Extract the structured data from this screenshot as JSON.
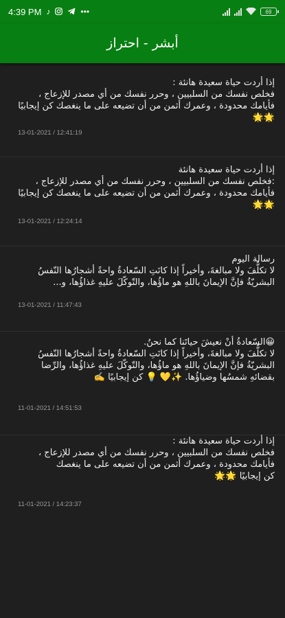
{
  "status_bar": {
    "time": "4:39 PM",
    "icons_left": [
      "tiktok-icon",
      "instagram-icon",
      "telegram-icon",
      "more-dots-icon"
    ],
    "battery": "69"
  },
  "app_bar": {
    "title": "أبشر - احتراز"
  },
  "messages": [
    {
      "text": "إذا أردت حياة سعيدة هانئة :\nفخلص نفسك من السلبيين ، وحرر نفسك من أي مصدر للإزعاج ، فأيامك محدودة ، وعمرك أثمن من أن تضيعه على ما ينغصك كن إيجابيًا 🌟🌟",
      "date": "13-01-2021 / 12:41:19"
    },
    {
      "text": "إذا أردت حياة سعيدة هانئة\n:فخلص نفسك من السلبيين ، وحرر نفسك من أي مصدر للإزعاج ، فأيامك محدودة ، وعمرك أثمن من أن تضيعه على ما ينغصك كن إيجابيًا 🌟🌟",
      "date": "13-01-2021 / 12:24:14"
    },
    {
      "text": "رسالة اليوم\nلا تكلُّفَ ولا مبالغةَ، وأخيراً إذا كانَتِ السّعادةُ واحةً أشجارُها النّفسُ البشريّةُ فإنَّ الإيمانَ باللهِ هو ماؤُها، والتّوكّلَ عليهِ غذاؤُها، و...",
      "date": "13-01-2021 / 11:47:43"
    },
    {
      "text": "😀السّعادةُ أنْ نعيشَ حياتَنا كما نحنُ.\nلا تكلُّفَ ولا مبالغةَ، وأخيراً إذا كانَتِ السّعادةُ واحةً أشجارُها النّفسُ البشريّةُ فإنَّ الإيمانَ باللهِ هو ماؤُها، والتّوكّلَ عليهِ غذاؤُها، والرِّضا بقضائهِ شمسُها وضياؤُها. ✨💛 💡 كن إيجابيًا ✍️",
      "date": "11-01-2021 / 14:51:53"
    },
    {
      "text": "إذا أردت حياة سعيدة هانئة :\nفخلص نفسك من السلبيين ، وحرر نفسك من أي مصدر للإزعاج ، فأيامك محدودة ، وعمرك أثمن من أن تضيعه على ما ينغصك\nكن إيجابيًا 🌟🌟",
      "date": "11-01-2021 / 14:23:37"
    }
  ]
}
